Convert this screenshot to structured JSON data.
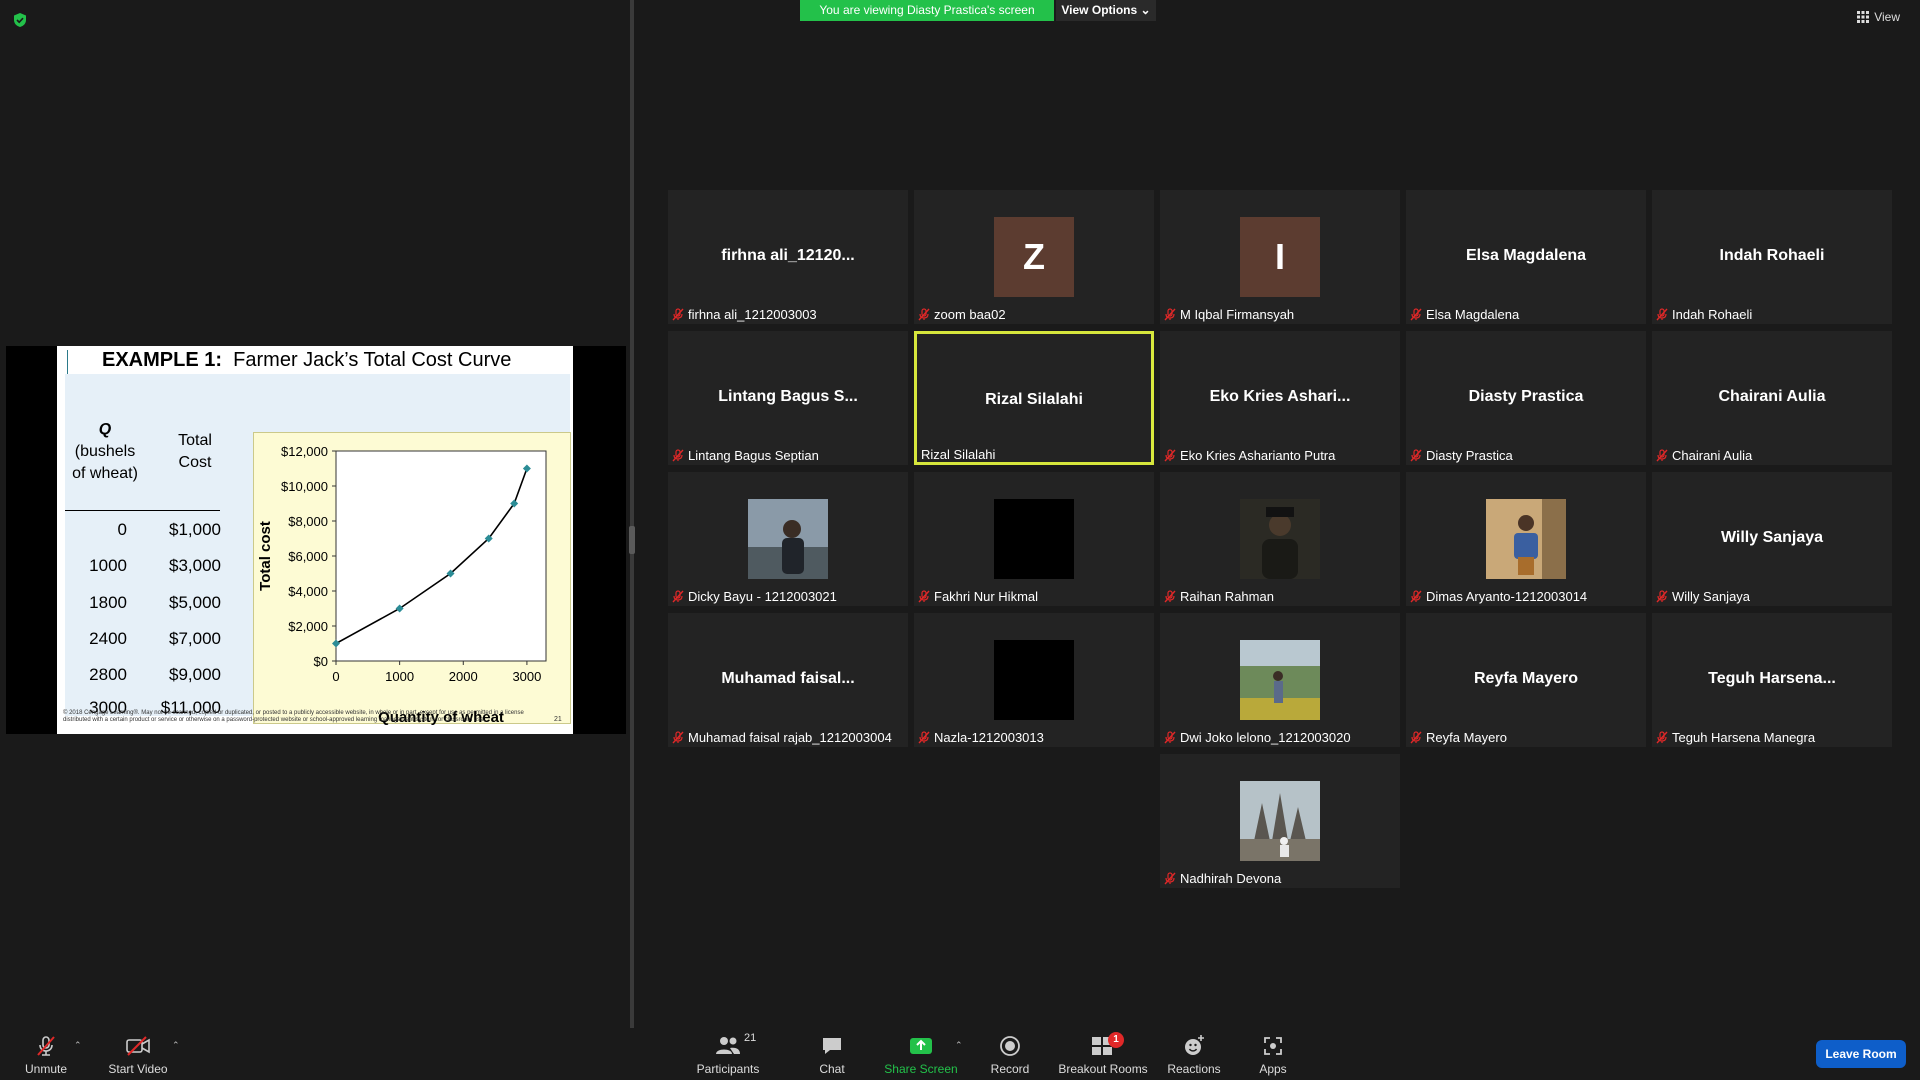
{
  "banner": {
    "viewing_text": "You are viewing Diasty Prastica's screen",
    "view_options_label": "View Options",
    "view_label": "View"
  },
  "slide": {
    "title_bold": "EXAMPLE 1:",
    "title_rest": "Farmer Jack’s Total Cost Curve",
    "table": {
      "col1_header_line1": "Q",
      "col1_header_line2": "(bushels",
      "col1_header_line3": "of wheat)",
      "col2_header_line1": "Total",
      "col2_header_line2": "Cost",
      "rows": [
        {
          "q": "0",
          "cost": "$1,000"
        },
        {
          "q": "1000",
          "cost": "$3,000"
        },
        {
          "q": "1800",
          "cost": "$5,000"
        },
        {
          "q": "2400",
          "cost": "$7,000"
        },
        {
          "q": "2800",
          "cost": "$9,000"
        },
        {
          "q": "3000",
          "cost": "$11,000"
        }
      ]
    },
    "copyright": "© 2018 Cengage Learning®. May not be scanned, copied or duplicated, or posted to a publicly accessible website, in whole or in part, except for use as permitted in a license distributed with a certain product or service or otherwise on a password-protected website or school-approved learning management system for classroom use.",
    "page_number": "21"
  },
  "chart_data": {
    "type": "line",
    "title": "",
    "xlabel": "Quantity of wheat",
    "ylabel": "Total cost",
    "x": [
      0,
      1000,
      1800,
      2400,
      2800,
      3000
    ],
    "series": [
      {
        "values": [
          1000,
          3000,
          5000,
          7000,
          9000,
          11000
        ]
      }
    ],
    "xlim": [
      0,
      3300
    ],
    "ylim": [
      0,
      12000
    ],
    "x_ticks": [
      0,
      1000,
      2000,
      3000
    ],
    "x_tick_labels": [
      "0",
      "1000",
      "2000",
      "3000"
    ],
    "y_ticks": [
      0,
      2000,
      4000,
      6000,
      8000,
      10000,
      12000
    ],
    "y_tick_labels": [
      "$0",
      "$2,000",
      "$4,000",
      "$6,000",
      "$8,000",
      "$10,000",
      "$12,000"
    ],
    "grid": false,
    "line_color": "#000000",
    "marker_color": "#2b8c96"
  },
  "participants": [
    {
      "big_name": "firhna  ali_12120...",
      "label": "firhna ali_1212003003",
      "muted": true,
      "avatar": "none"
    },
    {
      "big_name": "",
      "label": "zoom baa02",
      "muted": true,
      "avatar": "letter",
      "letter": "Z"
    },
    {
      "big_name": "",
      "label": "M Iqbal Firmansyah",
      "muted": true,
      "avatar": "letter",
      "letter": "I"
    },
    {
      "big_name": "Elsa Magdalena",
      "label": "Elsa Magdalena",
      "muted": true,
      "avatar": "none"
    },
    {
      "big_name": "Indah Rohaeli",
      "label": "Indah Rohaeli",
      "muted": true,
      "avatar": "none"
    },
    {
      "big_name": "Lintang Bagus S...",
      "label": "Lintang Bagus Septian",
      "muted": true,
      "avatar": "none"
    },
    {
      "big_name": "Rizal Silalahi",
      "label": "Rizal Silalahi",
      "muted": false,
      "avatar": "none",
      "active": true
    },
    {
      "big_name": "Eko  Kries  Ashari...",
      "label": "Eko Kries Asharianto Putra",
      "muted": true,
      "avatar": "none"
    },
    {
      "big_name": "Diasty Prastica",
      "label": "Diasty Prastica",
      "muted": true,
      "avatar": "none"
    },
    {
      "big_name": "Chairani Aulia",
      "label": "Chairani Aulia",
      "muted": true,
      "avatar": "none"
    },
    {
      "big_name": "",
      "label": "Dicky Bayu - 1212003021",
      "muted": true,
      "avatar": "photo",
      "photo": "beach"
    },
    {
      "big_name": "",
      "label": "Fakhri Nur Hikmal",
      "muted": true,
      "avatar": "black"
    },
    {
      "big_name": "",
      "label": "Raihan Rahman",
      "muted": true,
      "avatar": "photo",
      "photo": "dark"
    },
    {
      "big_name": "",
      "label": "Dimas Aryanto-1212003014",
      "muted": true,
      "avatar": "photo",
      "photo": "warm"
    },
    {
      "big_name": "Willy Sanjaya",
      "label": "Willy Sanjaya",
      "muted": true,
      "avatar": "none"
    },
    {
      "big_name": "Muhamad  faisal...",
      "label": "Muhamad faisal rajab_1212003004",
      "muted": true,
      "avatar": "none"
    },
    {
      "big_name": "",
      "label": "Nazla-1212003013",
      "muted": true,
      "avatar": "black"
    },
    {
      "big_name": "",
      "label": "Dwi Joko lelono_1212003020",
      "muted": true,
      "avatar": "photo",
      "photo": "park"
    },
    {
      "big_name": "Reyfa Mayero",
      "label": "Reyfa Mayero",
      "muted": true,
      "avatar": "none"
    },
    {
      "big_name": "Teguh  Harsena...",
      "label": "Teguh Harsena Manegra",
      "muted": true,
      "avatar": "none"
    },
    {
      "big_name": "",
      "label": "Nadhirah Devona",
      "muted": true,
      "avatar": "photo",
      "photo": "temple"
    }
  ],
  "toolbar": {
    "unmute_label": "Unmute",
    "start_video_label": "Start Video",
    "participants_label": "Participants",
    "participants_count": "21",
    "chat_label": "Chat",
    "share_label": "Share Screen",
    "record_label": "Record",
    "breakout_label": "Breakout Rooms",
    "breakout_badge": "1",
    "reactions_label": "Reactions",
    "apps_label": "Apps",
    "leave_label": "Leave Room"
  },
  "colors": {
    "share_green": "#23c14a",
    "active_border": "#d6e63c",
    "leave_blue": "#0e5ec9",
    "mute_red": "#e02828"
  }
}
